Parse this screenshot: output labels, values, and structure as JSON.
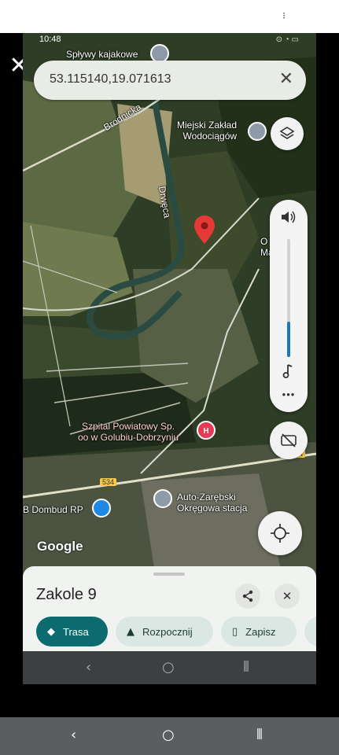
{
  "viewer": {
    "close_glyph": "✕",
    "menu_glyph": "⁝"
  },
  "status_bar": {
    "time": "10:48",
    "icons": "⊙ ◔ ▭"
  },
  "search": {
    "query": "53.115140,19.071613",
    "clear_glyph": "✕"
  },
  "map_labels": {
    "top_place": "Spływy kajakowe",
    "road": "Brodnicka",
    "water_works_line1": "Miejski Zakład",
    "water_works_line2": "Wodociągów",
    "river": "Drwęca",
    "person_line1": "O",
    "person_line2": "Małgorzata",
    "hospital_line1": "Szpital Powiatowy Sp.",
    "hospital_line2": "oo w Golubiu-Dobrzyniu",
    "auto_line1": "Auto-Zarębski",
    "auto_line2": "Okręgowa stacja",
    "company": "B Dombud RP",
    "road_number_1": "534",
    "road_number_2": "534",
    "logo": "Google"
  },
  "controls": {
    "layers_icon": "layers-icon",
    "volume_level_percent": 30,
    "more_glyph": "•••"
  },
  "place_sheet": {
    "title": "Zakole 9",
    "share_glyph": "⇪",
    "close_glyph": "✕",
    "actions": [
      {
        "label": "Trasa",
        "icon": "◆"
      },
      {
        "label": "Rozpocznij",
        "icon": "▲"
      },
      {
        "label": "Zapisz",
        "icon": "▯"
      }
    ]
  },
  "inner_nav": {
    "back": "‹",
    "home": "○",
    "recents": "⦀"
  },
  "system_nav": {
    "back": "‹",
    "home": "○",
    "recents": "⦀"
  },
  "colors": {
    "primary_chip": "#0b6b6e",
    "pin": "#e53935",
    "volume_fill": "#1b78c0"
  }
}
